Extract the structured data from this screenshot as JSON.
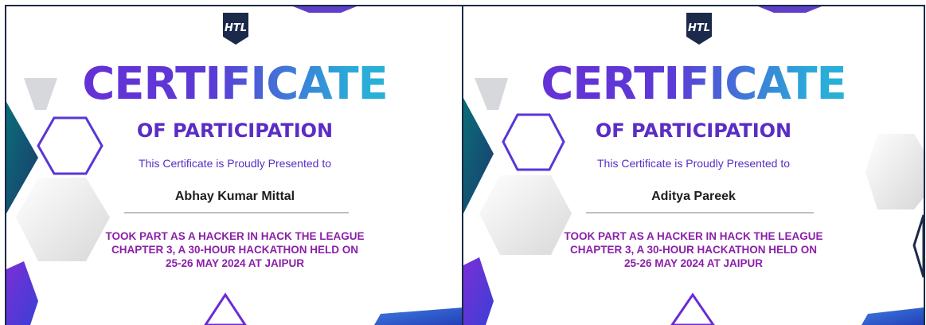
{
  "certificates": [
    {
      "logo_text": "HTL",
      "title": "CERTIFICATE",
      "subtitle": "OF PARTICIPATION",
      "presented_text": "This Certificate is Proudly Presented to",
      "recipient_name": "Abhay Kumar Mittal",
      "description_lines": [
        "TOOK PART AS A HACKER IN HACK THE LEAGUE",
        "CHAPTER 3, A 30-HOUR HACKATHON HELD ON",
        "25-26 MAY 2024 AT JAIPUR"
      ]
    },
    {
      "logo_text": "HTL",
      "title": "CERTIFICATE",
      "subtitle": "OF PARTICIPATION",
      "presented_text": "This Certificate is Proudly Presented to",
      "recipient_name": "Aditya Pareek",
      "description_lines": [
        "TOOK PART AS A HACKER IN HACK THE LEAGUE",
        "CHAPTER 3, A 30-HOUR HACKATHON HELD ON",
        "25-26 MAY 2024 AT JAIPUR"
      ]
    }
  ],
  "colors": {
    "title_gradient_start": "#6a2bd6",
    "title_gradient_end": "#26c3cf",
    "subtitle": "#5a2dc4",
    "description": "#8b1fa8",
    "logo_badge": "#1b2a4a"
  }
}
